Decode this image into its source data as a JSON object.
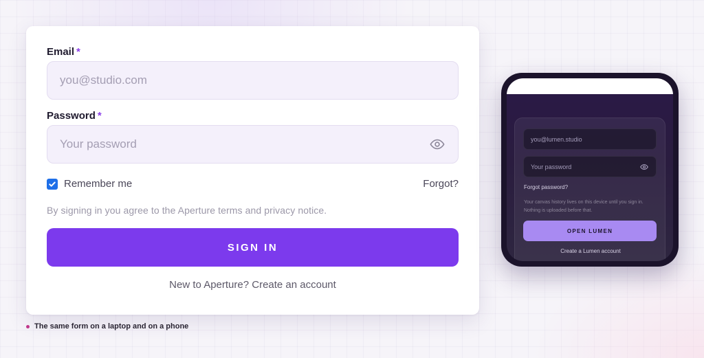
{
  "laptop_form": {
    "email_label": "Email",
    "email_required": "*",
    "email_placeholder": "you@studio.com",
    "password_label": "Password",
    "password_required": "*",
    "password_placeholder": "Your password",
    "password_toggle_icon": "eye-icon",
    "remember_label": "Remember me",
    "remember_checked": true,
    "forgot_label": "Forgot?",
    "terms_text": "By signing in you agree to the Aperture terms and privacy notice.",
    "submit_label": "SIGN IN",
    "create_account_label": "New to Aperture? Create an account",
    "accent_color": "#7c3aed"
  },
  "caption": {
    "text": "The same form on a laptop and on a phone"
  },
  "phone_form": {
    "email_placeholder": "you@lumen.studio",
    "password_placeholder": "Your password",
    "password_toggle_icon": "eye-icon",
    "forgot_label": "Forgot password?",
    "note_text": "Your canvas history lives on this device until you sign in. Nothing is uploaded before that.",
    "submit_label": "OPEN LUMEN",
    "create_account_label": "Create a Lumen account",
    "accent_color": "#a88af2"
  }
}
